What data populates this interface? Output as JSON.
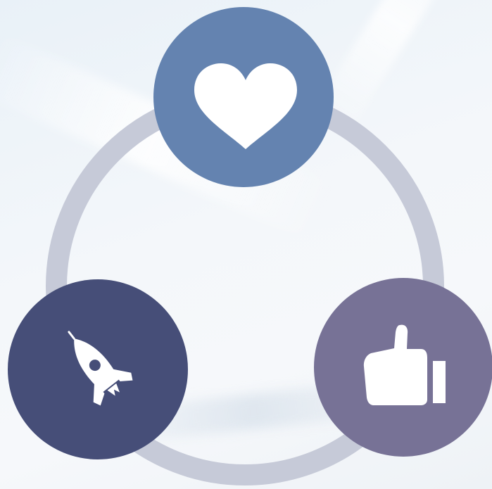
{
  "diagram": {
    "ring_color": "#c6cad8",
    "nodes": [
      {
        "id": "top",
        "icon": "heart-icon",
        "color": "#6483b0",
        "icon_color": "#ffffff"
      },
      {
        "id": "left",
        "icon": "rocket-icon",
        "color": "#464e78",
        "icon_color": "#ffffff"
      },
      {
        "id": "right",
        "icon": "thumbs-up-icon",
        "color": "#777296",
        "icon_color": "#ffffff"
      }
    ]
  }
}
